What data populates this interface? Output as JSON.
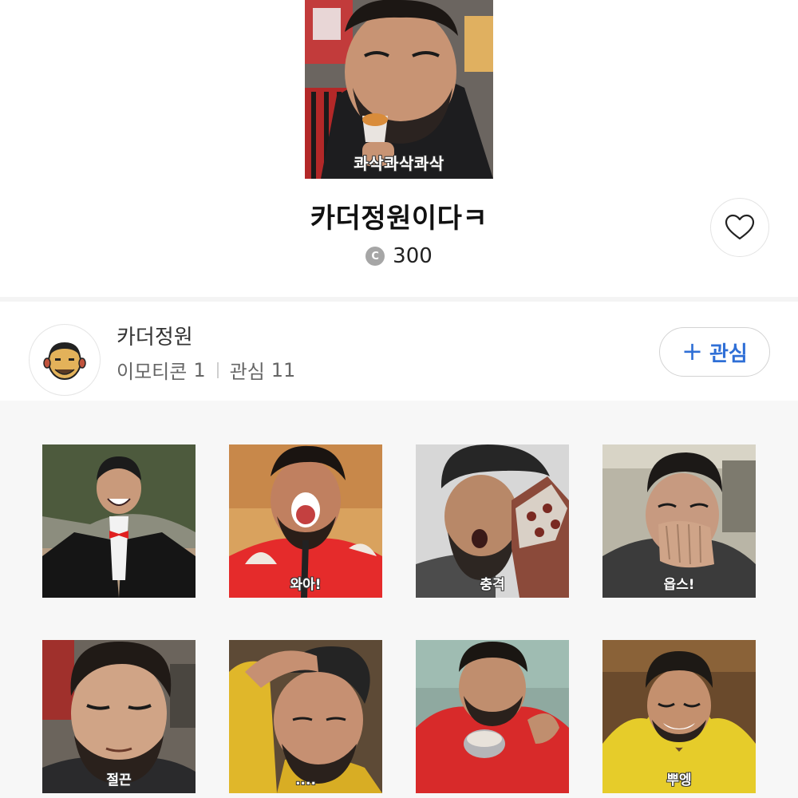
{
  "hero": {
    "caption": "콰삭콰삭콰삭",
    "title": "카더정원이다ㅋ",
    "price": "300",
    "coin_glyph": "C",
    "icons": {
      "like": "heart-icon",
      "coin": "coin-icon"
    }
  },
  "author": {
    "name": "카더정원",
    "emoticon_label": "이모티콘",
    "emoticon_count": "1",
    "follow_label": "관심",
    "follow_count": "11",
    "follow_button": "관심",
    "follow_icon": "plus-icon"
  },
  "stickers": [
    {
      "caption": ""
    },
    {
      "caption": "와아!"
    },
    {
      "caption": "충격"
    },
    {
      "caption": "읍스!"
    },
    {
      "caption": "절끈"
    },
    {
      "caption": "...."
    },
    {
      "caption": ""
    },
    {
      "caption": "뿌엥"
    }
  ],
  "colors": {
    "accent_blue": "#2f6fd6",
    "divider": "#f4f4f4",
    "grid_bg": "#f7f7f7"
  }
}
